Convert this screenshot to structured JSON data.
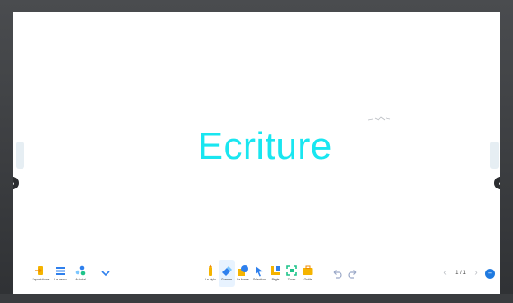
{
  "canvas": {
    "text": "Ecriture",
    "text_color": "#19e6f0"
  },
  "toolbar_left": {
    "items": [
      {
        "label": "Exportations",
        "icon": "export-icon"
      },
      {
        "label": "Le menu",
        "icon": "menu-icon"
      },
      {
        "label": "Au total",
        "icon": "apps-icon"
      }
    ],
    "expand_icon": "chevron-down-icon"
  },
  "toolbar_center": {
    "items": [
      {
        "label": "Le stylo",
        "icon": "pen-icon"
      },
      {
        "label": "Gomme",
        "icon": "eraser-icon",
        "active": true
      },
      {
        "label": "La forme",
        "icon": "shape-icon"
      },
      {
        "label": "Sélection",
        "icon": "select-icon"
      },
      {
        "label": "Règle",
        "icon": "ruler-icon"
      },
      {
        "label": "Zoom",
        "icon": "zoom-icon"
      },
      {
        "label": "Outils",
        "icon": "toolbox-icon"
      }
    ],
    "undo_icon": "undo-icon",
    "redo_icon": "redo-icon"
  },
  "pager": {
    "page_text": "1 / 1",
    "prev_icon": "chevron-left-icon",
    "next_icon": "chevron-right-icon",
    "add_icon": "add-page-icon"
  },
  "colors": {
    "accent": "#1f7ae0",
    "pen": "#f5b400",
    "eraser_active": "#2f80ed"
  }
}
